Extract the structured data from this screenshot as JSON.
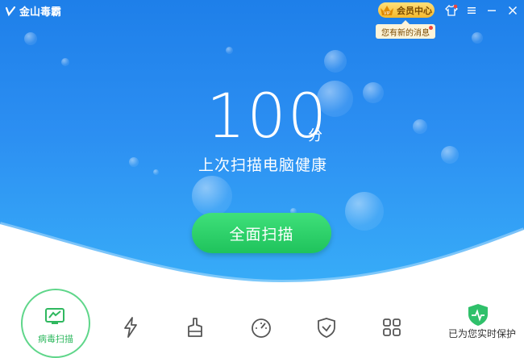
{
  "app": {
    "name": "金山毒霸"
  },
  "header": {
    "vip_badge": "VIP",
    "vip_label": "会员中心",
    "tooltip": "您有新的消息",
    "icons": [
      "skin-icon",
      "menu-icon",
      "minimize-icon",
      "close-icon"
    ]
  },
  "main": {
    "score": "100",
    "score_unit": "分",
    "subtitle": "上次扫描电脑健康",
    "scan_button": "全面扫描"
  },
  "toolbar": {
    "items": [
      {
        "icon": "computer-scan-icon",
        "label": "病毒扫描"
      },
      {
        "icon": "lightning-icon"
      },
      {
        "icon": "clean-broom-icon"
      },
      {
        "icon": "speedometer-icon"
      },
      {
        "icon": "shield-icon"
      },
      {
        "icon": "grid-apps-icon"
      },
      {
        "icon": "protection-shield-icon",
        "label": "已为您实时保护"
      }
    ]
  },
  "colors": {
    "primary_blue": "#2c8ff2",
    "scan_green": "#2ad167",
    "vip_gold": "#f5b82b"
  }
}
